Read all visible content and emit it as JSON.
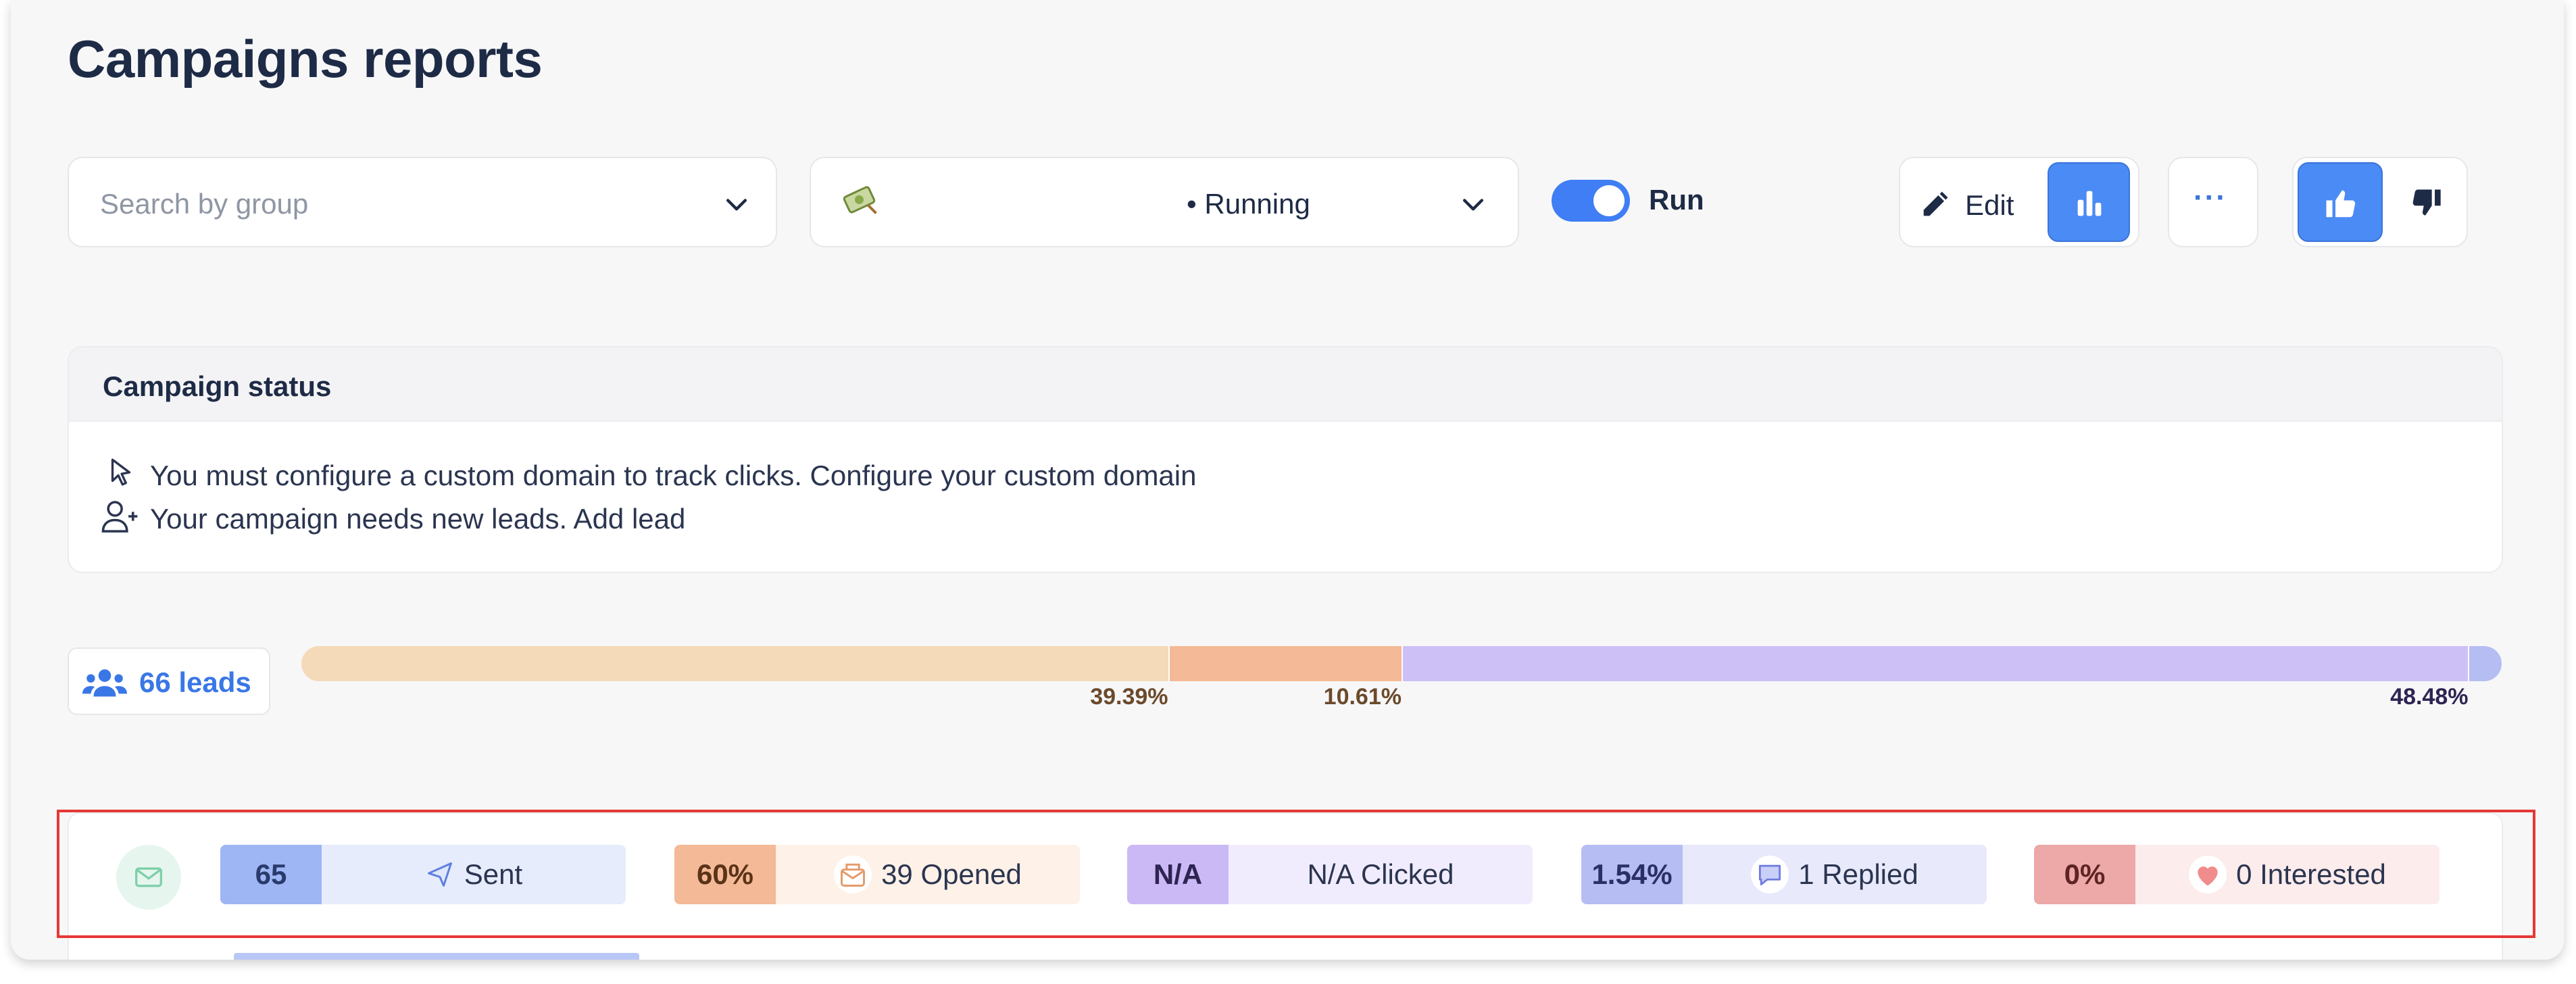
{
  "page": {
    "title": "Campaigns reports"
  },
  "filters": {
    "group_placeholder": "Search by group",
    "campaign_status": "• Running"
  },
  "toolbar": {
    "run_label": "Run",
    "run_enabled": true,
    "edit_label": "Edit",
    "more_label": "···"
  },
  "campaign_status": {
    "heading": "Campaign status",
    "messages": [
      {
        "icon": "cursor-icon",
        "text": "You must configure a custom domain to track clicks. Configure your custom domain"
      },
      {
        "icon": "add-user-icon",
        "text": "Your campaign needs new leads. Add lead"
      }
    ]
  },
  "leads": {
    "count_label": "66 leads",
    "distribution": [
      {
        "percent": 39.39,
        "label": "39.39%",
        "color": "#f4dab8"
      },
      {
        "percent": 10.61,
        "label": "10.61%",
        "color": "#f4b996"
      },
      {
        "percent": 48.48,
        "label": "48.48%",
        "color": "#cdc0f6"
      },
      {
        "percent": 1.52,
        "label": "",
        "color": "#b5bdf3"
      }
    ]
  },
  "stats": [
    {
      "value": "65",
      "label": "Sent",
      "icon": "send-icon",
      "num_bg": "#9fb6f5",
      "lab_bg": "#e6ecfb",
      "num_color": "#2a3a6c"
    },
    {
      "value": "60%",
      "label": "39 Opened",
      "icon": "open-mail-icon",
      "num_bg": "#f4b996",
      "lab_bg": "#fdf1e8",
      "num_color": "#5a3318"
    },
    {
      "value": "N/A",
      "label": "N/A Clicked",
      "icon": "",
      "num_bg": "#cbb9f6",
      "lab_bg": "#f1ecfd",
      "num_color": "#2e2452"
    },
    {
      "value": "1.54%",
      "label": "1 Replied",
      "icon": "chat-icon",
      "num_bg": "#b5bdf3",
      "lab_bg": "#e8eafb",
      "num_color": "#2a2f66"
    },
    {
      "value": "0%",
      "label": "0 Interested",
      "icon": "heart-icon",
      "num_bg": "#eda8a8",
      "lab_bg": "#fcecec",
      "num_color": "#5e2424"
    }
  ]
}
